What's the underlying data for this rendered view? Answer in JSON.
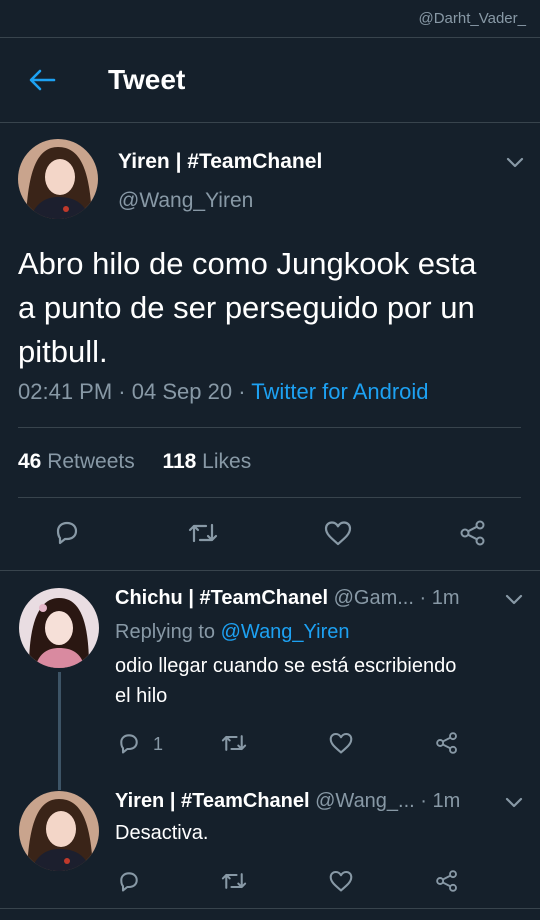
{
  "watermark": "@Darht_Vader_",
  "header": {
    "title": "Tweet"
  },
  "tweet": {
    "author_name": "Yiren | #TeamChanel",
    "author_handle": "@Wang_Yiren",
    "text_lines": [
      "Abro hilo de como Jungkook esta",
      "a punto de ser perseguido por un",
      "pitbull."
    ],
    "time": "02:41 PM",
    "date": "04 Sep 20",
    "source": "Twitter for Android",
    "retweets_count": "46",
    "retweets_label": "Retweets",
    "likes_count": "118",
    "likes_label": "Likes"
  },
  "replies": [
    {
      "name": "Chichu | #TeamChanel",
      "handle": "@Gam...",
      "time": "1m",
      "replying_prefix": "Replying to",
      "replying_to": "@Wang_Yiren",
      "text_lines": [
        "odio llegar cuando se está escribiendo",
        "el hilo"
      ],
      "reply_count": "1"
    },
    {
      "name": "Yiren | #TeamChanel",
      "handle": "@Wang_...",
      "time": "1m",
      "text_lines": [
        "Desactiva."
      ]
    }
  ],
  "colors": {
    "background": "#15202b",
    "accent": "#1da1f2",
    "secondary_text": "#8899a6",
    "divider": "#38444d"
  },
  "icons": [
    "back-arrow-icon",
    "chevron-down-icon",
    "reply-icon",
    "retweet-icon",
    "like-icon",
    "share-icon"
  ]
}
